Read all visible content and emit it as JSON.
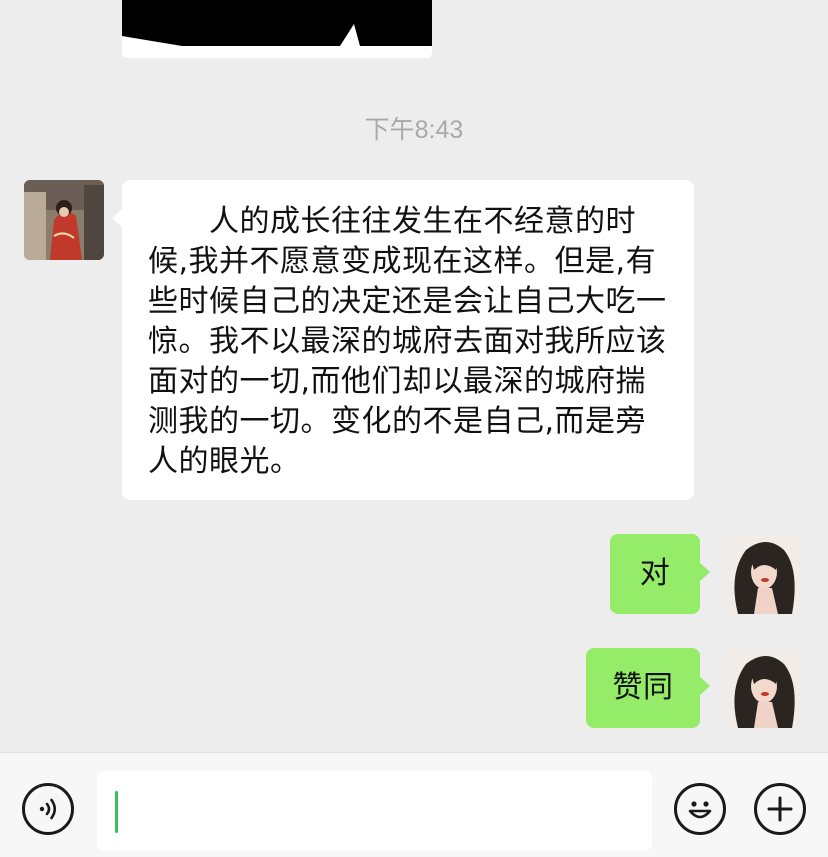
{
  "chat": {
    "timestamp": "下午8:43",
    "messages": [
      {
        "sender": "other",
        "text": "　　人的成长往往发生在不经意的时候,我并不愿意变成现在这样。但是,有些时候自己的决定还是会让自己大吃一惊。我不以最深的城府去面对我所应该面对的一切,而他们却以最深的城府揣测我的一切。变化的不是自己,而是旁人的眼光。"
      },
      {
        "sender": "me",
        "text": "对"
      },
      {
        "sender": "me",
        "text": "赞同"
      }
    ]
  },
  "input_bar": {
    "voice_icon": "voice-icon",
    "emoji_icon": "emoji-icon",
    "plus_icon": "plus-icon",
    "input_value": ""
  },
  "colors": {
    "background": "#ededed",
    "incoming_bubble": "#ffffff",
    "outgoing_bubble": "#95ec69",
    "timestamp": "#a9a9a9",
    "caret": "#3ebd5a"
  }
}
